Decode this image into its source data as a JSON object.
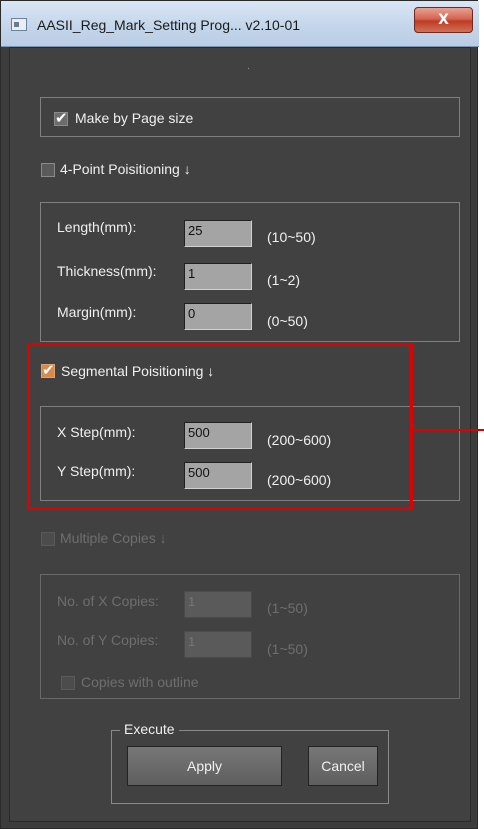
{
  "window": {
    "title": "AASII_Reg_Mark_Setting Prog... v2.10-01",
    "close_label": "X"
  },
  "dot_marker": ".",
  "make_by_page": {
    "label": "Make by Page size",
    "checked": true
  },
  "four_point": {
    "label": "4-Point Poisitioning ↓",
    "checked": false,
    "fields": [
      {
        "label": "Length(mm):",
        "value": "25",
        "range": "(10~50)"
      },
      {
        "label": "Thickness(mm):",
        "value": "1",
        "range": "(1~2)"
      },
      {
        "label": "Margin(mm):",
        "value": "0",
        "range": "(0~50)"
      }
    ]
  },
  "segmental": {
    "label": "Segmental Poisitioning ↓",
    "checked": true,
    "fields": [
      {
        "label": "X Step(mm):",
        "value": "500",
        "range": "(200~600)"
      },
      {
        "label": "Y Step(mm):",
        "value": "500",
        "range": "(200~600)"
      }
    ]
  },
  "multiple": {
    "label": "Multiple Copies ↓",
    "checked": false,
    "fields": [
      {
        "label": "No. of X Copies:",
        "value": "1",
        "range": "(1~50)"
      },
      {
        "label": "No. of Y Copies:",
        "value": "1",
        "range": "(1~50)"
      }
    ],
    "outline_label": "Copies with outline"
  },
  "execute": {
    "legend": "Execute",
    "apply_label": "Apply",
    "cancel_label": "Cancel"
  },
  "colors": {
    "highlight": "#e00000",
    "background": "#414141"
  }
}
